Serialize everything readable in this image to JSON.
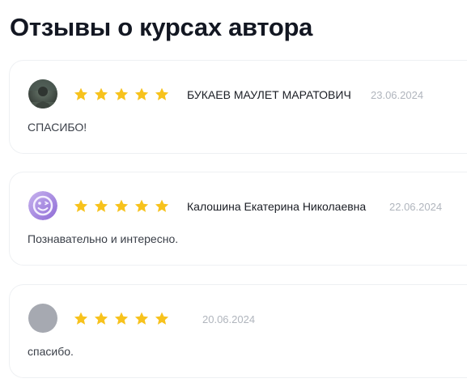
{
  "heading": "Отзывы о курсах автора",
  "colors": {
    "star": "#f7c21c",
    "date": "#b0b5bd"
  },
  "reviews": [
    {
      "author": "БУКАЕВ МАУЛЕТ МАРАТОВИЧ",
      "date": "23.06.2024",
      "text": "СПАСИБО!",
      "rating": 5,
      "avatar": "photo"
    },
    {
      "author": "Калошина Екатерина Николаевна",
      "date": "22.06.2024",
      "text": "Познавательно и интересно.",
      "rating": 5,
      "avatar": "smiley-icon"
    },
    {
      "author": "",
      "date": "20.06.2024",
      "text": "спасибо.",
      "rating": 5,
      "avatar": "placeholder"
    }
  ]
}
